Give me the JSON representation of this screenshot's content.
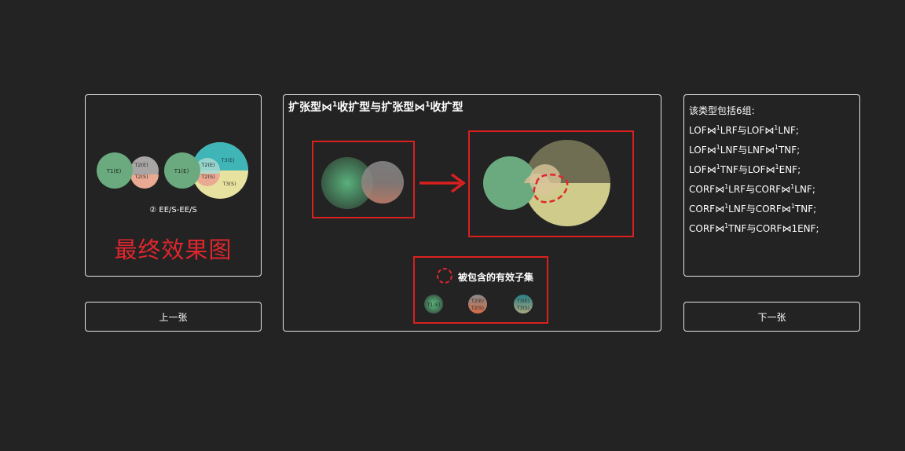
{
  "left_panel": {
    "venn_left": {
      "t1": "T1(E)",
      "t2e": "T2(E)",
      "t2s": "T2(S)"
    },
    "venn_right": {
      "t1": "T1(E)",
      "t2e": "T2(E)",
      "t2s": "T2(S)",
      "t3e": "T3(E)",
      "t3s": "T3(S)"
    },
    "caption": "② EE/S-EE/S",
    "final_label": "最终效果图"
  },
  "center_panel": {
    "title_parts": [
      "扩张型⋈",
      "1",
      "收扩型与扩张型⋈",
      "1",
      "收扩型"
    ],
    "legend": {
      "label": "被包含的有效子集",
      "items": [
        {
          "top": "T1(E)",
          "bottom": ""
        },
        {
          "top": "T2(E)",
          "bottom": "T2(S)"
        },
        {
          "top": "T3(E)",
          "bottom": "T3(S)"
        }
      ]
    }
  },
  "right_panel": {
    "heading": "该类型包括6组:",
    "lines": [
      {
        "a": "LOF⋈",
        "sup1": "1",
        "b": "LRF与LOF⋈",
        "sup2": "1",
        "c": "LNF;"
      },
      {
        "a": "LOF⋈",
        "sup1": "1",
        "b": "LNF与LNF⋈",
        "sup2": "1",
        "c": "TNF;"
      },
      {
        "a": "LOF⋈",
        "sup1": "1",
        "b": "TNF与LOF⋈",
        "sup2": "1",
        "c": "ENF;"
      },
      {
        "a": "CORF⋈",
        "sup1": "1",
        "b": "LRF与CORF⋈",
        "sup2": "1",
        "c": "LNF;"
      },
      {
        "a": "CORF⋈",
        "sup1": "1",
        "b": "LNF与CORF⋈",
        "sup2": "1",
        "c": "TNF;"
      },
      {
        "a": "CORF⋈",
        "sup1": "1",
        "b": "TNF与CORF⋈1ENF;",
        "sup2": "",
        "c": ""
      }
    ]
  },
  "nav": {
    "prev_label": "上一张",
    "next_label": "下一张"
  },
  "colors": {
    "background": "#232324",
    "border": "#e6e6e6",
    "highlight_red": "#e0262d",
    "t1_green": "#6aaa7e",
    "t2_grey": "#9a9a9a",
    "t2s_salmon": "#e6a08a",
    "t3_teal": "#3fb5b8",
    "t3s_yellow": "#e8e2a0"
  }
}
